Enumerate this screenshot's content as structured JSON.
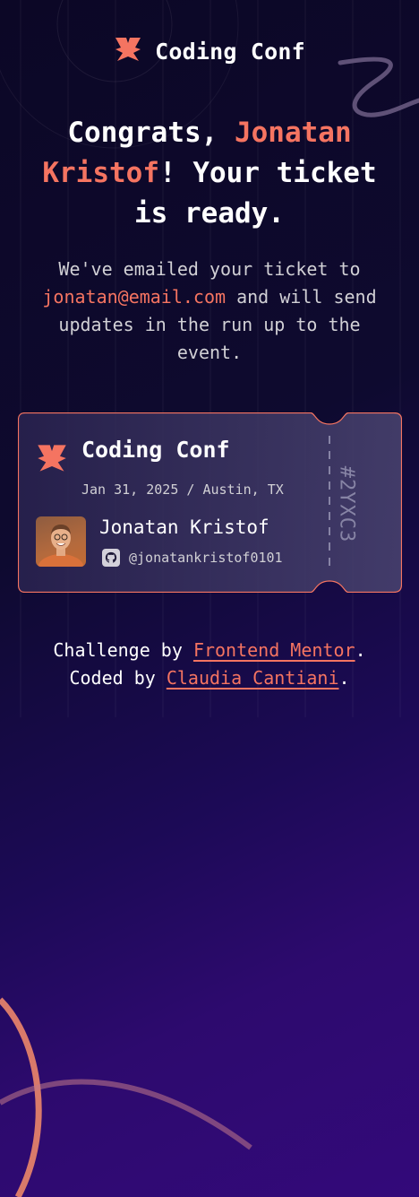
{
  "header": {
    "brand": "Coding Conf",
    "logo_icon": "coding-conf-logo-icon"
  },
  "headline": {
    "prefix": "Congrats, ",
    "name": "Jonatan Kristof",
    "suffix": "! Your ticket is ready."
  },
  "subtext": {
    "prefix": "We've emailed your ticket to ",
    "email": "jonatan@email.com",
    "suffix": " and will send updates in the run up to the event."
  },
  "ticket": {
    "brand": "Coding Conf",
    "date_location": "Jan 31, 2025 / Austin, TX",
    "attendee_name": "Jonatan Kristof",
    "github_handle": "@jonatankristof0101",
    "ticket_number": "#2YXC3"
  },
  "footer": {
    "challenge_prefix": "Challenge by ",
    "challenge_link": "Frontend Mentor",
    "challenge_suffix": ".",
    "coded_prefix": "Coded by ",
    "coded_link": "Claudia Cantiani",
    "coded_suffix": "."
  },
  "colors": {
    "accent": "#f57461",
    "background_dark": "#0c0726",
    "background_purple": "#33097a",
    "ticket_border": "#f57461"
  }
}
